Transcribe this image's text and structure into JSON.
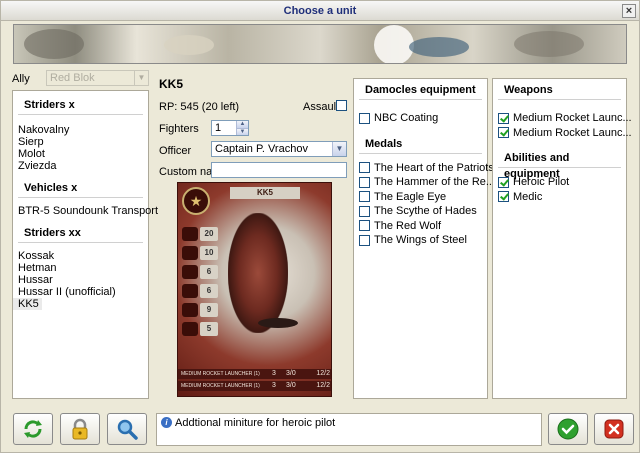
{
  "window": {
    "title": "Choose a unit",
    "close_glyph": "×"
  },
  "ally": {
    "label": "Ally",
    "value": "Red Blok"
  },
  "unit_list": {
    "sections": [
      {
        "title": "Striders x",
        "items": [
          "Nakovalny",
          "Sierp",
          "Molot",
          "Zviezda"
        ]
      },
      {
        "title": "Vehicles x",
        "items": [
          "BTR-5 Soundounk Transport"
        ]
      },
      {
        "title": "Striders xx",
        "items": [
          "Kossak",
          "Hetman",
          "Hussar",
          "Hussar II (unofficial)",
          "KK5"
        ]
      }
    ],
    "selected": "KK5"
  },
  "unit": {
    "name": "KK5",
    "rp": "RP: 545 (20 left)",
    "assault_label": "Assault",
    "fighters_label": "Fighters",
    "fighters_value": "1",
    "officer_label": "Officer",
    "officer_value": "Captain P. Vrachov",
    "custom_name_label": "Custom name",
    "custom_name_value": ""
  },
  "card": {
    "name": "KK5",
    "stats": [
      "20",
      "10",
      "6",
      "6",
      "9",
      "5"
    ],
    "weapon_rows": [
      {
        "name": "MEDIUM ROCKET LAUNCHER (1)",
        "v1": "3",
        "v2": "3/0",
        "v3": "12/2"
      },
      {
        "name": "MEDIUM ROCKET LAUNCHER (1)",
        "v1": "3",
        "v2": "3/0",
        "v3": "12/2"
      }
    ]
  },
  "damocles": {
    "title": "Damocles equipment",
    "items": [
      {
        "label": "NBC Coating",
        "checked": false
      }
    ]
  },
  "medals": {
    "title": "Medals",
    "items": [
      {
        "label": "The Heart of the Patriots",
        "checked": false
      },
      {
        "label": "The Hammer of the Re...",
        "checked": false
      },
      {
        "label": "The Eagle Eye",
        "checked": false
      },
      {
        "label": "The Scythe of Hades",
        "checked": false
      },
      {
        "label": "The Red Wolf",
        "checked": false
      },
      {
        "label": "The Wings of Steel",
        "checked": false
      }
    ]
  },
  "weapons": {
    "title": "Weapons",
    "items": [
      {
        "label": "Medium Rocket Launc...",
        "checked": true
      },
      {
        "label": "Medium Rocket Launc...",
        "checked": true
      }
    ]
  },
  "abilities": {
    "title": "Abilities and equipment",
    "items": [
      {
        "label": "Heroic Pilot",
        "checked": true
      },
      {
        "label": "Medic",
        "checked": true
      }
    ]
  },
  "status": {
    "message": "Addtional miniture for heroic pilot"
  },
  "icons": {
    "refresh": "refresh-icon",
    "lock": "lock-icon",
    "search": "search-icon",
    "ok": "ok-icon",
    "cancel": "cancel-icon",
    "info": "info-icon"
  },
  "colors": {
    "title_text": "#1f2f7a",
    "ok_green": "#2fa02f",
    "cancel_red": "#d23020",
    "check_green": "#21a121"
  }
}
